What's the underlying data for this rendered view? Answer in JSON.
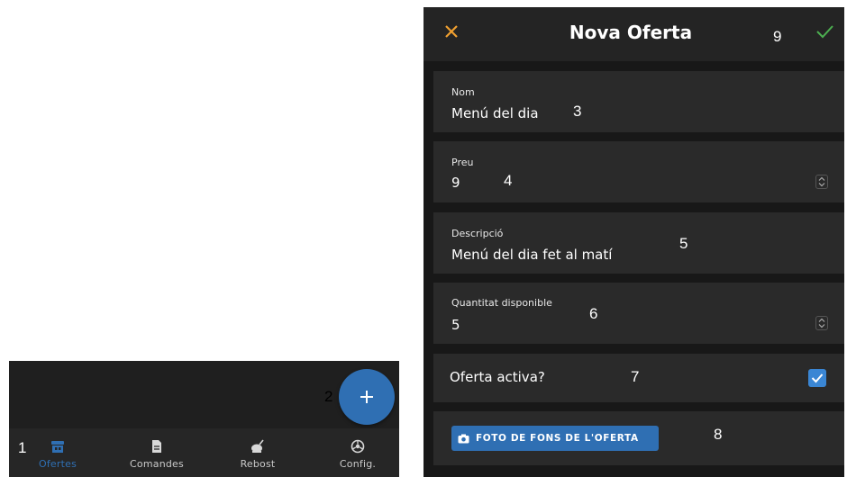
{
  "left_panel": {
    "fab": {
      "icon": "plus-icon"
    },
    "tabs": [
      {
        "label": "Ofertes",
        "icon": "store-icon",
        "active": true
      },
      {
        "label": "Comandes",
        "icon": "document-icon",
        "active": false
      },
      {
        "label": "Rebost",
        "icon": "pantry-icon",
        "active": false
      },
      {
        "label": "Config.",
        "icon": "settings-icon",
        "active": false
      }
    ],
    "annotations": {
      "tabs": "1",
      "fab": "2"
    }
  },
  "form": {
    "header": {
      "title": "Nova Oferta",
      "close_icon": "close-icon",
      "confirm_icon": "check-icon"
    },
    "fields": [
      {
        "label": "Nom",
        "value": "Menú del dia"
      },
      {
        "label": "Preu",
        "value": "9"
      },
      {
        "label": "Descripció",
        "value": "Menú del dia fet al matí"
      },
      {
        "label": "Quantitat disponible",
        "value": "5"
      }
    ],
    "active_toggle": {
      "label": "Oferta activa?",
      "checked": true
    },
    "photo_button": {
      "label": "FOTO DE FONS DE L'OFERTA",
      "icon": "camera-icon"
    },
    "annotations": {
      "nom": "3",
      "preu": "4",
      "descripcio": "5",
      "quantitat": "6",
      "activa": "7",
      "foto": "8",
      "confirm": "9"
    }
  },
  "colors": {
    "accent_blue": "#2f6fb3",
    "close_orange": "#f0a030",
    "confirm_green": "#4caf50",
    "background_dark": "#181818",
    "field_bg": "#2a2a2a"
  }
}
